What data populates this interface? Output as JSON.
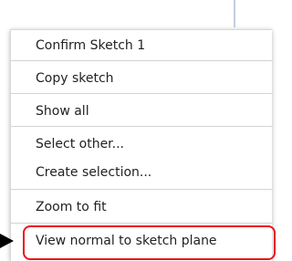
{
  "context_menu": {
    "items": [
      {
        "label": "Confirm Sketch 1"
      },
      {
        "label": "Copy sketch"
      },
      {
        "label": "Show all"
      },
      {
        "label": "Select other..."
      },
      {
        "label": "Create selection..."
      },
      {
        "label": "Zoom to fit"
      },
      {
        "label": "View normal to sketch plane"
      }
    ],
    "highlighted_item": "View normal to sketch plane"
  },
  "colors": {
    "highlight_border": "#e8151b",
    "pointer_arrow": "#000000"
  },
  "icons": {
    "pointer": "arrow-right-icon"
  }
}
